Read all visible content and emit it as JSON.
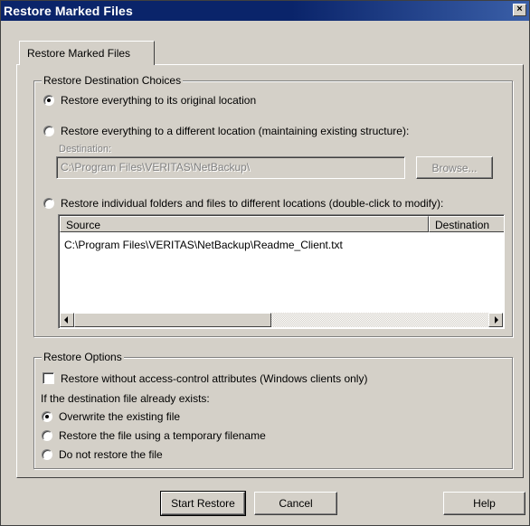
{
  "window": {
    "title": "Restore Marked Files",
    "close_glyph": "×"
  },
  "tab": {
    "label": "Restore Marked Files"
  },
  "destination_group": {
    "label": "Restore Destination Choices",
    "option_original": "Restore everything to its original location",
    "option_different": "Restore everything to a different location (maintaining existing structure):",
    "destination_label": "Destination:",
    "destination_value": "C:\\Program Files\\VERITAS\\NetBackup\\",
    "browse_label": "Browse...",
    "option_individual": "Restore individual folders and files to different locations (double-click to modify):",
    "selected": "original",
    "list": {
      "columns": [
        "Source",
        "Destination"
      ],
      "rows": [
        {
          "source": "C:\\Program Files\\VERITAS\\NetBackup\\Readme_Client.txt",
          "destination": ""
        }
      ]
    }
  },
  "options_group": {
    "label": "Restore Options",
    "checkbox_acl": "Restore without access-control attributes (Windows clients only)",
    "checkbox_acl_checked": false,
    "exists_label": "If the destination file already exists:",
    "option_overwrite": "Overwrite the existing file",
    "option_temp": "Restore the file using a temporary filename",
    "option_skip": "Do not restore the file",
    "selected": "overwrite"
  },
  "buttons": {
    "start": "Start Restore",
    "cancel": "Cancel",
    "help": "Help"
  },
  "icons": {
    "close": "close-icon",
    "scroll_left": "arrow-left-icon",
    "scroll_right": "arrow-right-icon"
  }
}
